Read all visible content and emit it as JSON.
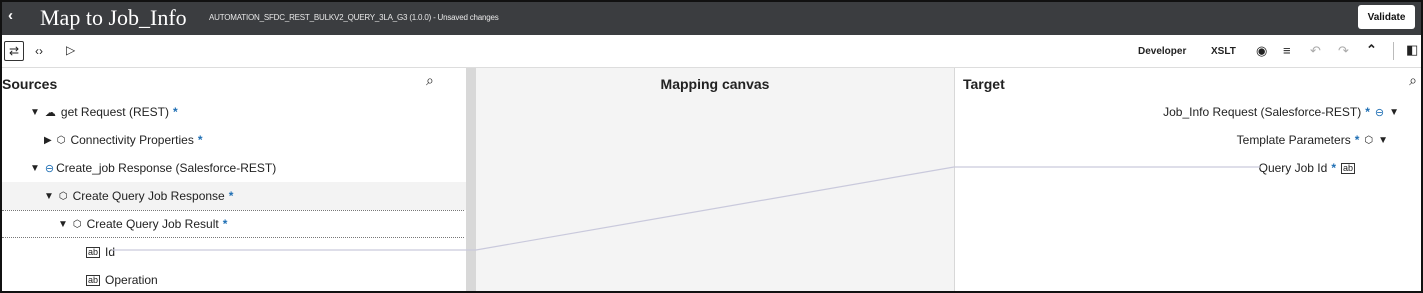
{
  "header": {
    "back": "‹",
    "title": "Map to Job_Info",
    "subtitle": "AUTOMATION_SFDC_REST_BULKV2_QUERY_3LA_G3 (1.0.0) - Unsaved changes",
    "validate_label": "Validate"
  },
  "toolbar": {
    "mode_labels": [
      "Developer",
      "XSLT"
    ]
  },
  "sources": {
    "title": "Sources",
    "rows": [
      {
        "label": "get Request (REST)",
        "star": "*"
      },
      {
        "label": "Connectivity Properties",
        "star": "*"
      },
      {
        "label": "Create_job Response (Salesforce-REST)",
        "star": ""
      },
      {
        "label": "Create Query Job Response",
        "star": "*"
      },
      {
        "label": "Create Query Job Result",
        "star": "*"
      },
      {
        "label": "Id",
        "star": ""
      },
      {
        "label": "Operation",
        "star": ""
      }
    ]
  },
  "canvas": {
    "title": "Mapping canvas"
  },
  "target": {
    "title": "Target",
    "rows": [
      {
        "label": "Job_Info Request (Salesforce-REST)",
        "star": "*"
      },
      {
        "label": "Template Parameters",
        "star": "*"
      },
      {
        "label": "Query Job Id",
        "star": "*"
      }
    ]
  },
  "icons": {
    "back": "chevron-left-icon",
    "search": "search-icon",
    "mapping_line_color": "#c9c9dc"
  }
}
